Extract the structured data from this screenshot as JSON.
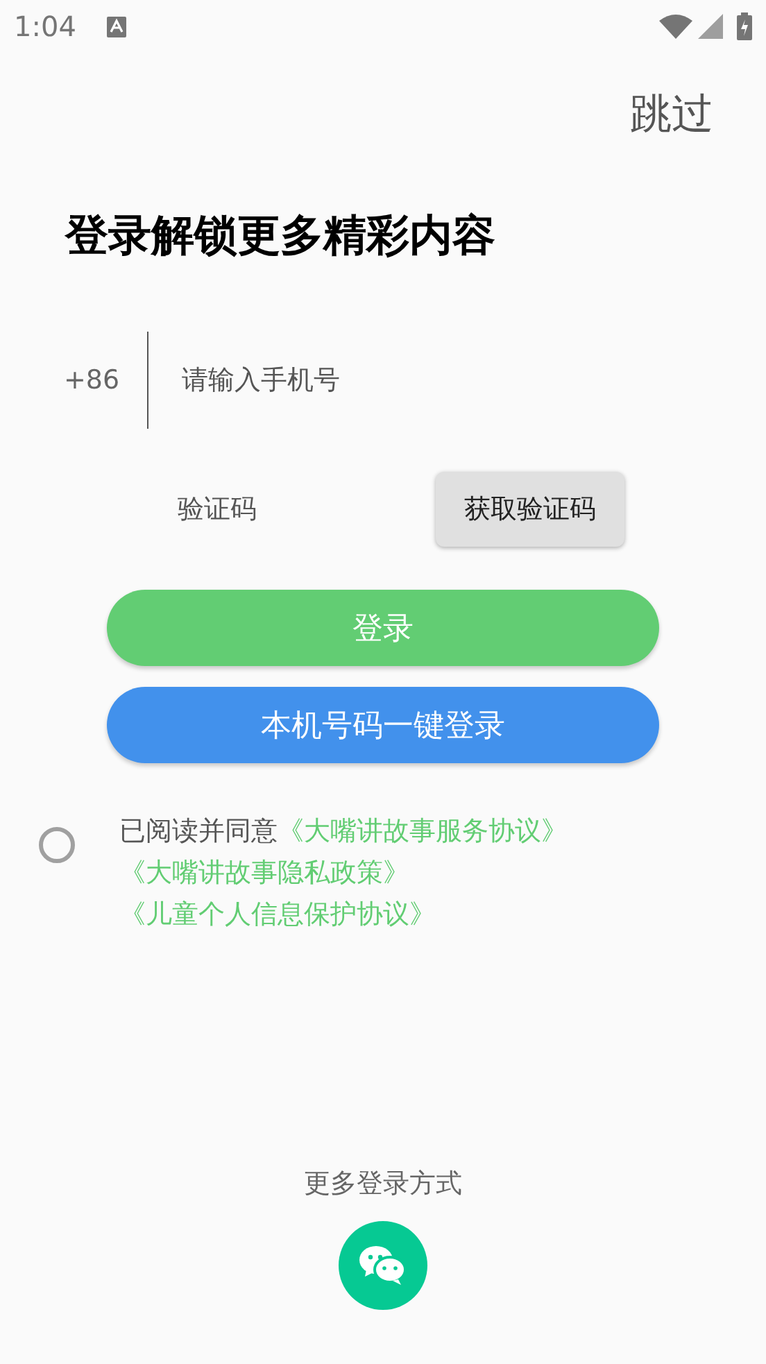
{
  "status_bar": {
    "time": "1:04"
  },
  "skip": "跳过",
  "title": "登录解锁更多精彩内容",
  "phone": {
    "prefix": "+86",
    "placeholder": "请输入手机号"
  },
  "code": {
    "placeholder": "验证码",
    "button": "获取验证码"
  },
  "buttons": [
    {
      "kind": "login",
      "label": "登录"
    },
    {
      "kind": "onekey",
      "label": "本机号码一键登录"
    }
  ],
  "agreement": {
    "checked": false,
    "text": "已阅读并同意",
    "links": [
      "《大嘴讲故事服务协议》",
      "《大嘴讲故事隐私政策》",
      "《儿童个人信息保护协议》"
    ]
  },
  "more_login": {
    "label": "更多登录方式"
  }
}
